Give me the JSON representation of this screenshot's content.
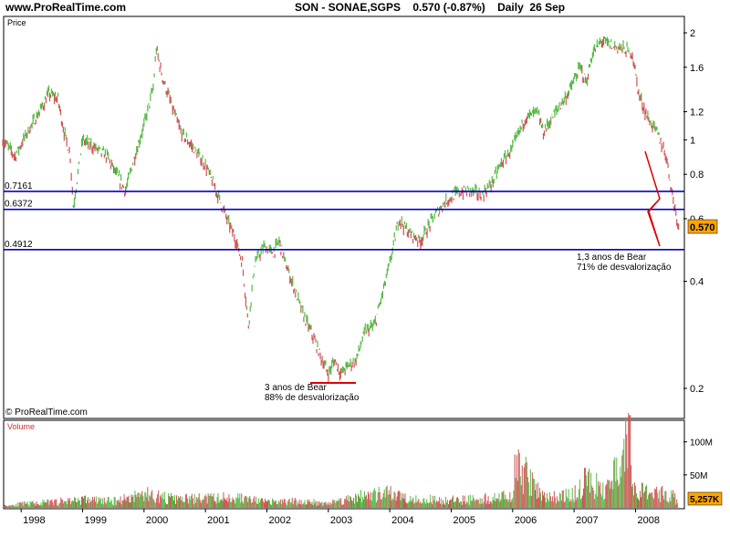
{
  "header": {
    "site": "www.ProRealTime.com",
    "quote": "SON - SONAE,SGPS    0.570 (-0.87%)    Daily  26 Sep"
  },
  "price_panel": {
    "label": "Price",
    "copyright": "© ProRealTime.com",
    "current_price_tag": "0.570"
  },
  "volume_panel": {
    "label": "Volume",
    "current_volume_tag": "5,257K"
  },
  "annotations": {
    "bear_2003_line1": "3 anos de Bear",
    "bear_2003_line2": "88% de desvalorização",
    "bear_2008_line1": "1,3 anos de Bear",
    "bear_2008_line2": "71% de desvalorização"
  },
  "chart_data": [
    {
      "type": "line",
      "title": "SON - SONAE,SGPS 0.570 (-0.87%) Daily 26 Sep",
      "ylabel": "Price",
      "yscale": "log",
      "ylim": [
        0.18,
        2.2
      ],
      "y_ticks": [
        "2",
        "1.6",
        "1.2",
        "1",
        "0.8",
        "0.6",
        "0.4",
        "0.2"
      ],
      "x_ticks": [
        "1998",
        "1999",
        "2000",
        "2001",
        "2002",
        "2003",
        "2004",
        "2005",
        "2006",
        "2007",
        "2008"
      ],
      "horizontal_levels": [
        {
          "label": "0.7161",
          "value": 0.7161,
          "color": "#0000cc"
        },
        {
          "label": "0.6372",
          "value": 0.6372,
          "color": "#0000cc"
        },
        {
          "label": "0.4912",
          "value": 0.4912,
          "color": "#0000cc"
        }
      ],
      "series": [
        {
          "x": [
            1997.7,
            1997.9,
            1998.1,
            1998.3,
            1998.45,
            1998.6,
            1998.7,
            1998.8,
            1998.85,
            1999.0,
            1999.2,
            1999.4,
            1999.55,
            1999.7,
            1999.85,
            2000.0,
            2000.15,
            2000.2,
            2000.3,
            2000.45,
            2000.6,
            2000.8,
            2001.0,
            2001.2,
            2001.35,
            2001.5,
            2001.6,
            2001.7,
            2001.8,
            2001.95,
            2002.1,
            2002.2,
            2002.3,
            2002.45,
            2002.6,
            2002.75,
            2002.9,
            2003.0,
            2003.1,
            2003.2,
            2003.3,
            2003.45,
            2003.6,
            2003.75,
            2003.9,
            2004.0,
            2004.15,
            2004.3,
            2004.5,
            2004.7,
            2004.9,
            2005.1,
            2005.3,
            2005.5,
            2005.65,
            2005.8,
            2006.0,
            2006.2,
            2006.4,
            2006.5,
            2006.7,
            2006.9,
            2007.1,
            2007.2,
            2007.3,
            2007.45,
            2007.6,
            2007.8,
            2007.95,
            2008.05,
            2008.2,
            2008.35,
            2008.5,
            2008.6,
            2008.7
          ],
          "y": [
            1.0,
            0.9,
            1.05,
            1.2,
            1.35,
            1.3,
            1.05,
            0.9,
            0.65,
            1.0,
            0.95,
            0.9,
            0.8,
            0.72,
            0.9,
            1.1,
            1.4,
            1.8,
            1.5,
            1.25,
            1.05,
            0.95,
            0.85,
            0.7,
            0.6,
            0.52,
            0.45,
            0.3,
            0.45,
            0.5,
            0.48,
            0.52,
            0.45,
            0.38,
            0.32,
            0.28,
            0.24,
            0.22,
            0.24,
            0.22,
            0.23,
            0.24,
            0.29,
            0.3,
            0.38,
            0.45,
            0.6,
            0.55,
            0.52,
            0.6,
            0.67,
            0.71,
            0.72,
            0.7,
            0.75,
            0.85,
            0.95,
            1.15,
            1.2,
            1.05,
            1.2,
            1.35,
            1.6,
            1.45,
            1.75,
            1.9,
            1.85,
            1.8,
            1.75,
            1.35,
            1.15,
            1.05,
            0.9,
            0.7,
            0.57
          ]
        }
      ]
    },
    {
      "type": "bar",
      "ylabel": "Volume",
      "ylim": [
        0,
        130
      ],
      "y_ticks": [
        "100M",
        "50M"
      ],
      "x": [
        1997.7,
        1998.0,
        1998.5,
        1999.0,
        1999.5,
        2000.0,
        2000.5,
        2001.0,
        2001.5,
        2002.0,
        2002.5,
        2003.0,
        2003.5,
        2004.0,
        2004.5,
        2005.0,
        2005.5,
        2006.0,
        2006.05,
        2006.5,
        2007.0,
        2007.2,
        2007.5,
        2007.9,
        2008.0,
        2008.3,
        2008.6,
        2008.7
      ],
      "values": [
        4,
        8,
        12,
        18,
        14,
        30,
        18,
        20,
        22,
        12,
        14,
        10,
        24,
        30,
        18,
        16,
        20,
        24,
        95,
        22,
        28,
        60,
        34,
        140,
        38,
        28,
        32,
        5.257
      ]
    }
  ]
}
